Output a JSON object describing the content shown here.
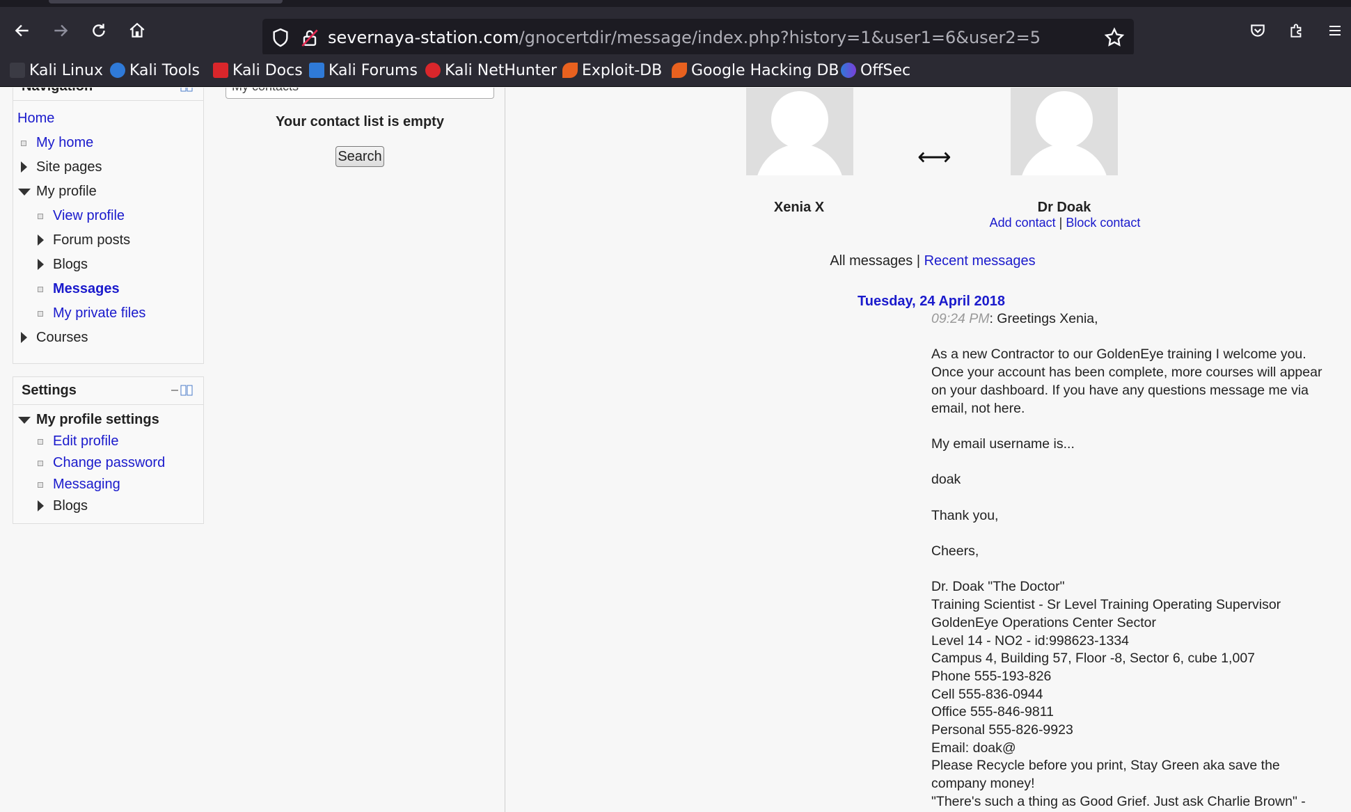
{
  "browser": {
    "url_domain": "severnaya-station.com",
    "url_path": "/gnocertdir/message/index.php?history=1&user1=6&user2=5",
    "bookmarks": [
      "Kali Linux",
      "Kali Tools",
      "Kali Docs",
      "Kali Forums",
      "Kali NetHunter",
      "Exploit-DB",
      "Google Hacking DB",
      "OffSec"
    ]
  },
  "navigation": {
    "title": "Navigation",
    "items": {
      "home": "Home",
      "my_home": "My home",
      "site_pages": "Site pages",
      "my_profile": "My profile",
      "view_profile": "View profile",
      "forum_posts": "Forum posts",
      "blogs": "Blogs",
      "messages": "Messages",
      "private_files": "My private files",
      "courses": "Courses"
    }
  },
  "settings": {
    "title": "Settings",
    "items": {
      "profile_settings": "My profile settings",
      "edit_profile": "Edit profile",
      "change_password": "Change password",
      "messaging": "Messaging",
      "blogs": "Blogs"
    }
  },
  "contacts": {
    "select_value": "My contacts",
    "empty_text": "Your contact list is empty",
    "search_label": "Search"
  },
  "conversation": {
    "user1": "Xenia X",
    "user2": "Dr Doak",
    "arrow": "⟷",
    "add_contact": "Add contact",
    "separator": " | ",
    "block_contact": "Block contact",
    "all_messages": "All messages",
    "recent_messages": "Recent messages",
    "date": "Tuesday, 24 April 2018",
    "time": "09:24 PM",
    "greeting": ": Greetings Xenia,",
    "lines": [
      "",
      "As a new Contractor to our GoldenEye training I welcome you.",
      "Once your account has been complete, more courses will appear",
      "on your dashboard. If you have any questions message me via",
      "email, not here.",
      "",
      "My email username is...",
      "",
      "doak",
      "",
      "Thank you,",
      "",
      "Cheers,",
      "",
      "Dr. Doak \"The Doctor\"",
      "Training Scientist - Sr Level Training Operating Supervisor",
      "GoldenEye Operations Center Sector",
      "Level 14 - NO2 - id:998623-1334",
      "Campus 4, Building 57, Floor -8, Sector 6, cube 1,007",
      "Phone 555-193-826",
      "Cell 555-836-0944",
      "Office 555-846-9811",
      "Personal 555-826-9923",
      "Email: doak@",
      "Please Recycle before you print, Stay Green aka save the",
      "company money!",
      "\"There's such a thing as Good Grief. Just ask Charlie Brown\" -"
    ]
  }
}
